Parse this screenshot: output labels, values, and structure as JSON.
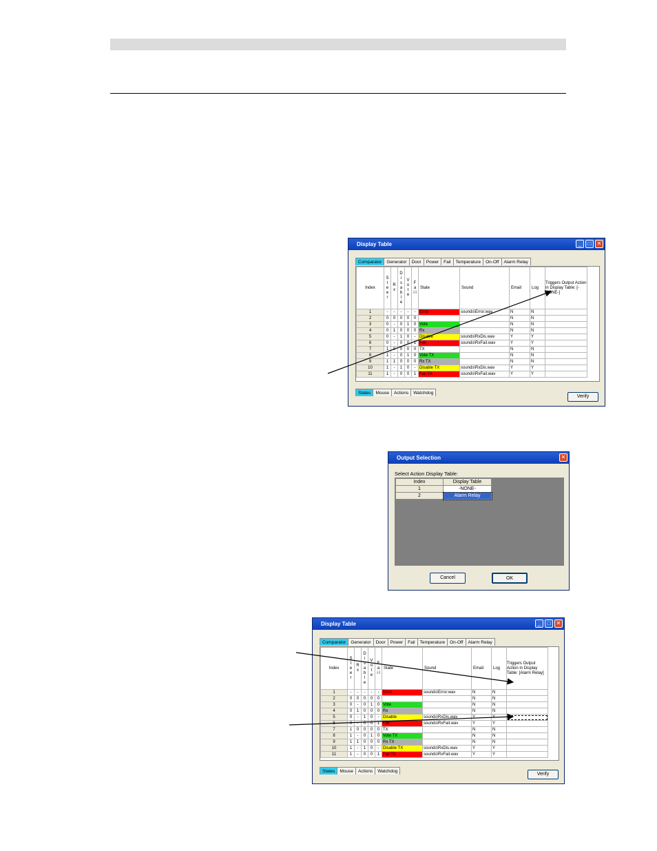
{
  "colors": {
    "error": "#ff0000",
    "vote": "#22dd22",
    "rx": "#b0b0b0",
    "disable": "#ffff00",
    "fail": "#ff0000",
    "active_tab": "#33ccee",
    "alarm_selected": "#3366cc"
  },
  "window1": {
    "title": "Display Table",
    "tabs": [
      "Comparator",
      "Generator",
      "Door",
      "Power",
      "Fail",
      "Temperature",
      "On-Off",
      "Alarm Relay"
    ],
    "bottom_tabs": [
      "States",
      "Mouse",
      "Actions",
      "Watchdog"
    ],
    "verify_label": "Verify",
    "headers": {
      "index": "Index",
      "steer": "S t e e r",
      "rx": "R x",
      "disable": "D i s a b l e",
      "vote": "V o t e",
      "fail": "F a i l",
      "state": "State",
      "sound": "Sound",
      "email": "Email",
      "log": "Log",
      "triggers": "Triggers Output Action in Display Table: [-NONE-]"
    },
    "rows": [
      {
        "i": "1",
        "s": "-",
        "r": "-",
        "d": "-",
        "v": "-",
        "f": "-",
        "state": "Error",
        "c": "error",
        "sound": "sounds\\Error.wav",
        "e": "N",
        "l": "N"
      },
      {
        "i": "2",
        "s": "0",
        "r": "0",
        "d": "0",
        "v": "0",
        "f": "0",
        "state": "",
        "c": "",
        "sound": "",
        "e": "N",
        "l": "N"
      },
      {
        "i": "3",
        "s": "0",
        "r": "-",
        "d": "0",
        "v": "1",
        "f": "0",
        "state": "Vote",
        "c": "vote",
        "sound": "",
        "e": "N",
        "l": "N"
      },
      {
        "i": "4",
        "s": "0",
        "r": "1",
        "d": "0",
        "v": "0",
        "f": "0",
        "state": "Rx",
        "c": "rx",
        "sound": "",
        "e": "N",
        "l": "N"
      },
      {
        "i": "5",
        "s": "0",
        "r": "-",
        "d": "1",
        "v": "0",
        "f": "-",
        "state": "Disable",
        "c": "disable",
        "sound": "sounds\\RxDis.wav",
        "e": "Y",
        "l": "Y"
      },
      {
        "i": "6",
        "s": "0",
        "r": "-",
        "d": "0",
        "v": "0",
        "f": "1",
        "state": "Fail",
        "c": "fail",
        "sound": "sounds\\RxFail.wav",
        "e": "Y",
        "l": "Y"
      },
      {
        "i": "7",
        "s": "1",
        "r": "0",
        "d": "0",
        "v": "0",
        "f": "0",
        "state": "TX",
        "c": "",
        "sound": "",
        "e": "N",
        "l": "N"
      },
      {
        "i": "8",
        "s": "1",
        "r": "-",
        "d": "0",
        "v": "1",
        "f": "0",
        "state": "Vote TX",
        "c": "vote",
        "sound": "",
        "e": "N",
        "l": "N"
      },
      {
        "i": "9",
        "s": "1",
        "r": "1",
        "d": "0",
        "v": "0",
        "f": "0",
        "state": "Rx TX",
        "c": "rx",
        "sound": "",
        "e": "N",
        "l": "N"
      },
      {
        "i": "10",
        "s": "1",
        "r": "-",
        "d": "1",
        "v": "0",
        "f": "-",
        "state": "Disable TX",
        "c": "disable",
        "sound": "sounds\\RxDis.wav",
        "e": "Y",
        "l": "Y"
      },
      {
        "i": "11",
        "s": "1",
        "r": "-",
        "d": "0",
        "v": "0",
        "f": "1",
        "state": "Fail TX",
        "c": "fail",
        "sound": "sounds\\RxFail.wav",
        "e": "Y",
        "l": "Y"
      }
    ]
  },
  "dialog": {
    "title": "Output Selection",
    "prompt": "Select Action Display Table:",
    "col_index": "Index",
    "col_table": "Display Table",
    "rows": [
      {
        "i": "1",
        "t": "-NONE-"
      },
      {
        "i": "2",
        "t": "Alarm Relay"
      }
    ],
    "cancel_label": "Cancel",
    "ok_label": "OK"
  },
  "window2": {
    "title": "Display Table",
    "triggers": "Triggers Output Action in Display Table: [Alarm Relay]"
  }
}
